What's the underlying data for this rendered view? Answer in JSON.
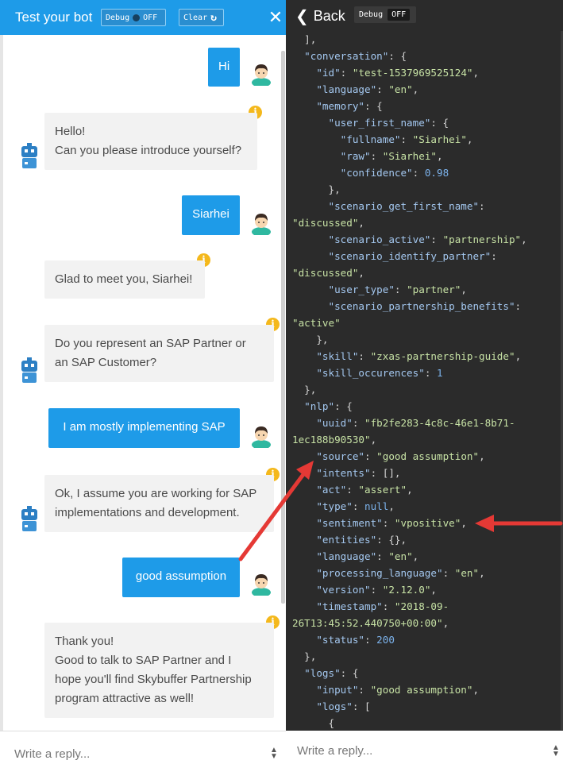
{
  "left": {
    "title": "Test your bot",
    "debug_label": "Debug",
    "debug_state": "OFF",
    "clear_label": "Clear",
    "close_icon": "close-icon",
    "reply_placeholder": "Write a reply...",
    "messages": [
      {
        "from": "user",
        "text": "Hi"
      },
      {
        "from": "bot",
        "lines": [
          "Hello!",
          "Can you please introduce yourself?"
        ]
      },
      {
        "from": "user",
        "text": "Siarhei"
      },
      {
        "from": "bot",
        "lines": [
          "Glad to meet you, Siarhei!"
        ]
      },
      {
        "from": "bot",
        "lines": [
          "Do you represent an SAP Partner or",
          "an SAP Customer?"
        ]
      },
      {
        "from": "user",
        "text": "I am mostly implementing SAP"
      },
      {
        "from": "bot",
        "lines": [
          "Ok, I assume you are working for SAP",
          "implementations and development."
        ]
      },
      {
        "from": "user",
        "text": "good assumption"
      },
      {
        "from": "bot",
        "lines": [
          "Thank you!",
          "Good to talk to SAP Partner and I",
          "hope you'll find  Skybuffer Partnership",
          "program attractive as well!"
        ]
      }
    ]
  },
  "right": {
    "back_label": "Back",
    "debug_label": "Debug",
    "debug_state": "OFF",
    "reply_placeholder": "Write a reply..."
  },
  "colors": {
    "header_blue": "#1e9be8",
    "user_bubble": "#1e9be8",
    "bot_bubble": "#f2f2f2",
    "info_badge": "#f4b81c",
    "dark_panel": "#2b2b2b",
    "arrow": "#e53935"
  }
}
